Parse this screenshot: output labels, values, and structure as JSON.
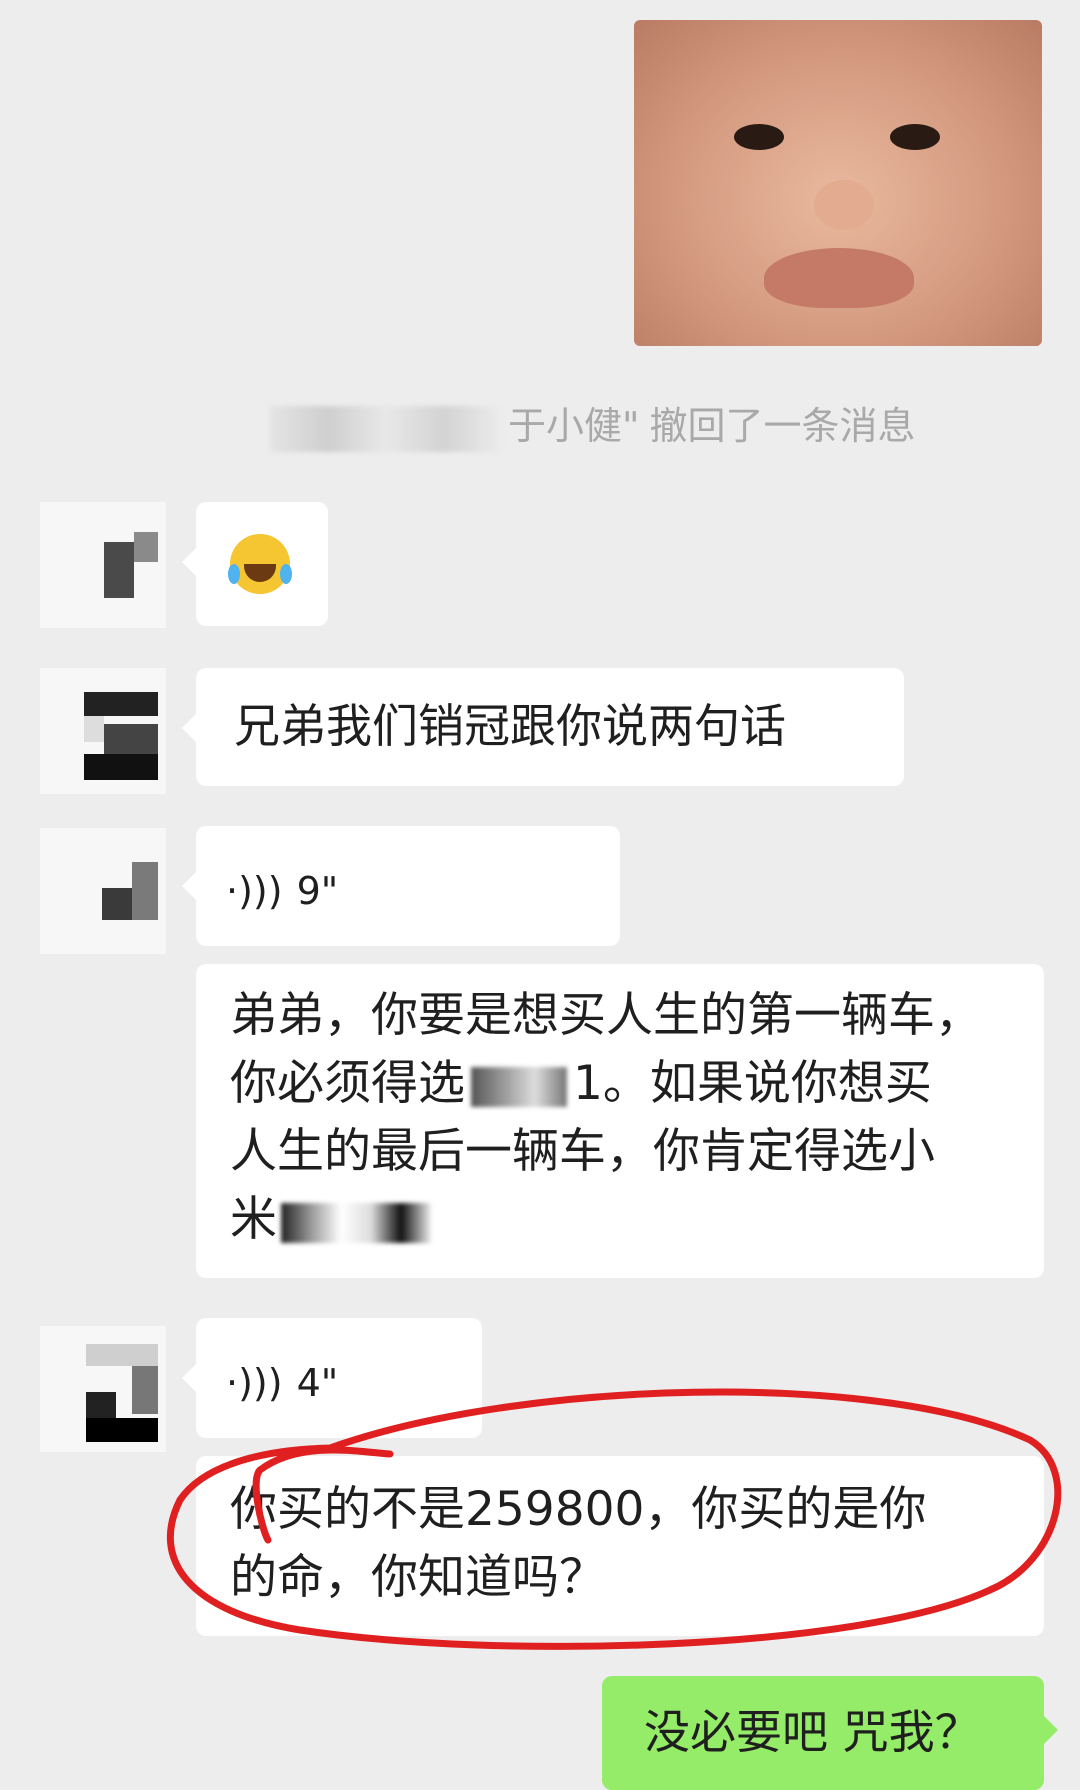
{
  "recall_note": {
    "name_visible_part": "于小健\"",
    "text": "撤回了一条消息"
  },
  "messages": {
    "emoji": {
      "icon": "tears-of-joy-emoji-icon"
    },
    "text1": "兄弟我们销冠跟你说两句话",
    "voice1": {
      "duration": "9\""
    },
    "text2": {
      "line1": "弟弟，你要是想买人生的第一辆车，",
      "line2_a": "你必须得选",
      "line2_b": "1。如果说你想买",
      "line3": "人生的最后一辆车，你肯定得选小",
      "line4_a": "米"
    },
    "voice2": {
      "duration": "4\""
    },
    "text3": {
      "line1": "你买的不是259800，你买的是你",
      "line2": "的命，你知道吗？"
    },
    "sent_reply": "没必要吧 咒我？"
  },
  "colors": {
    "background": "#ededed",
    "bubble_in": "#ffffff",
    "bubble_out": "#95ec69",
    "annotation": "#e02020"
  }
}
